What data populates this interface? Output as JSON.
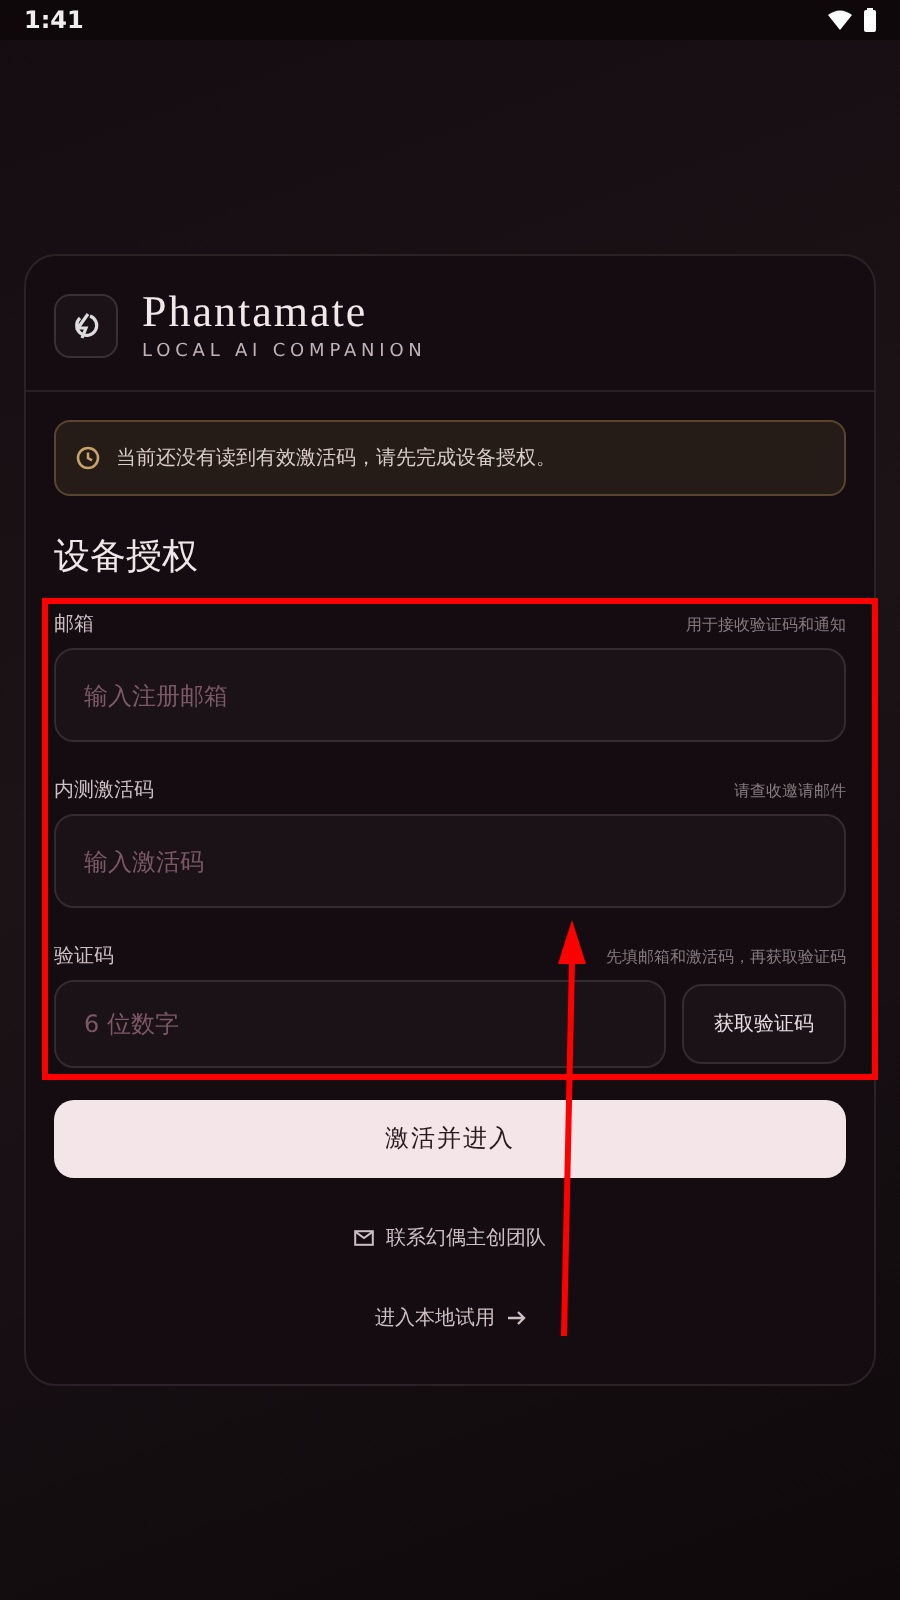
{
  "status_bar": {
    "time": "1:41"
  },
  "app": {
    "name": "Phantamate",
    "tagline": "LOCAL AI COMPANION"
  },
  "notice": {
    "text": "当前还没有读到有效激活码，请先完成设备授权。"
  },
  "heading": "设备授权",
  "fields": [
    {
      "label": "邮箱",
      "hint": "用于接收验证码和通知",
      "placeholder": "输入注册邮箱"
    },
    {
      "label": "内测激活码",
      "hint": "请查收邀请邮件",
      "placeholder": "输入激活码"
    },
    {
      "label": "验证码",
      "hint": "先填邮箱和激活码，再获取验证码",
      "placeholder": "6 位数字",
      "button": "获取验证码"
    }
  ],
  "primary_button": "激活并进入",
  "contact_link": "联系幻偶主创团队",
  "trial_link": "进入本地试用"
}
